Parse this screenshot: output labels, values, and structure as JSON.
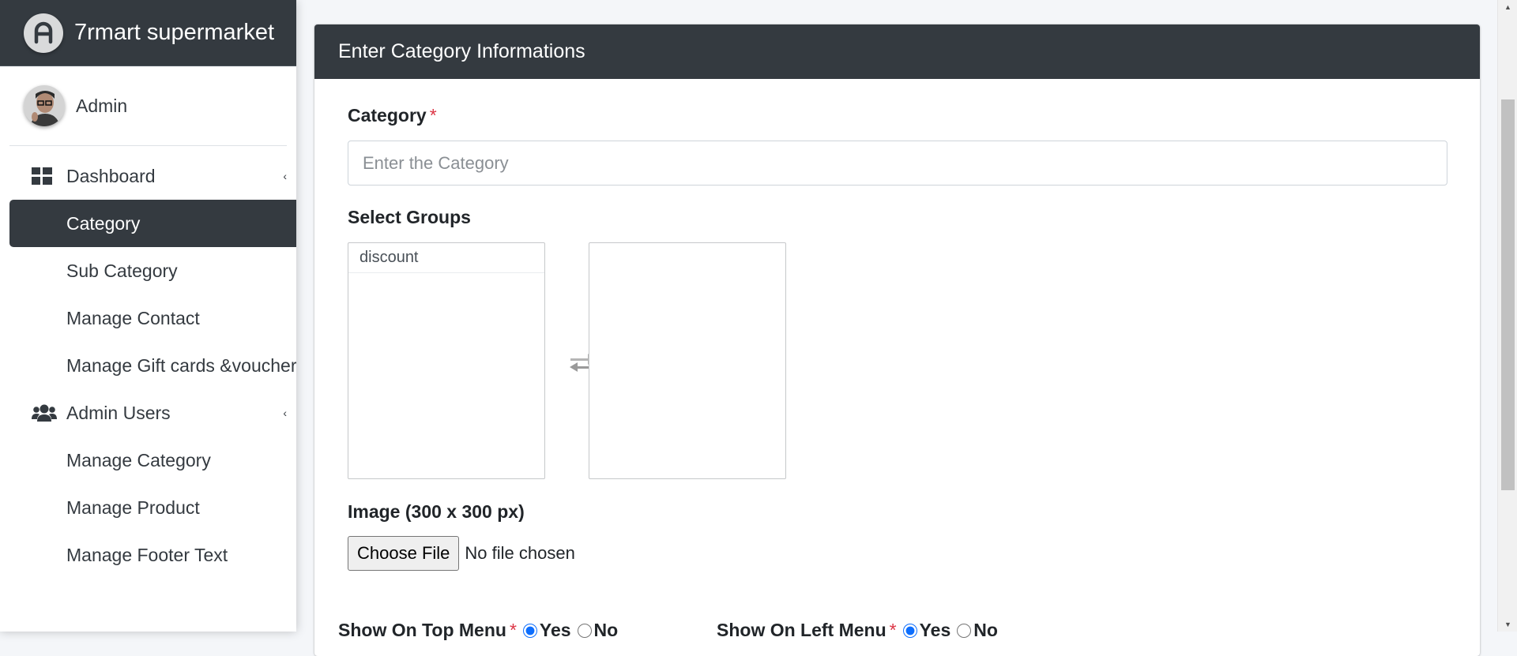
{
  "brand": {
    "name": "7rmart supermarket"
  },
  "user": {
    "name": "Admin"
  },
  "sidebar": {
    "items": [
      {
        "label": "Dashboard",
        "icon": "dashboard-icon"
      },
      {
        "label": "Category",
        "active": true
      },
      {
        "label": "Sub Category"
      },
      {
        "label": "Manage Contact"
      },
      {
        "label": "Manage Gift cards &voucher"
      },
      {
        "label": "Admin Users",
        "icon": "users-icon"
      },
      {
        "label": "Manage Category"
      },
      {
        "label": "Manage Product"
      },
      {
        "label": "Manage Footer Text"
      }
    ]
  },
  "form": {
    "header": "Enter Category Informations",
    "category_label": "Category",
    "required_mark": "*",
    "category_placeholder": "Enter the Category",
    "groups_label": "Select Groups",
    "available_groups": [
      "discount"
    ],
    "selected_groups": [],
    "image_label": "Image (300 x 300 px)",
    "file_button": "Choose File",
    "file_status": "No file chosen",
    "top_menu_label": "Show On Top Menu",
    "left_menu_label": "Show On Left Menu",
    "yes_label": "Yes",
    "no_label": "No"
  },
  "colors": {
    "dark": "#343a40",
    "required": "#dc3545",
    "background": "#f4f6f9"
  }
}
